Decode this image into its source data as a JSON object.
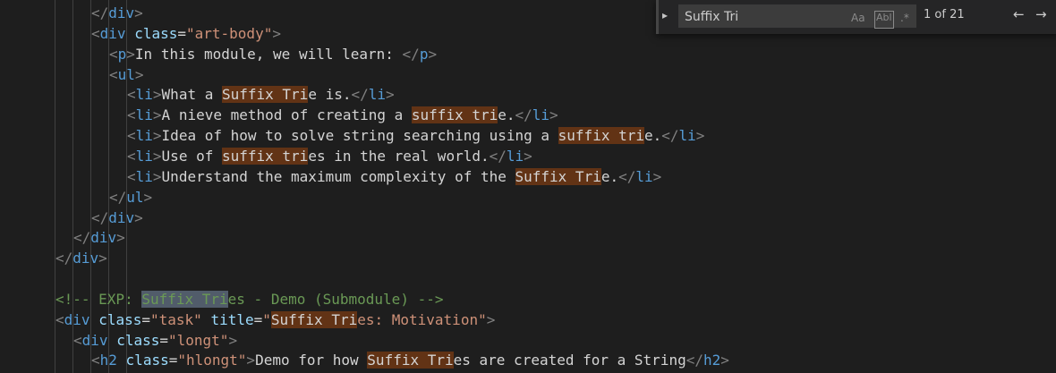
{
  "find_widget": {
    "toggle_icon": "chevron-right-icon",
    "query": "Suffix Tri",
    "match_case_label": "Aa",
    "whole_word_label": "Abl",
    "regex_label": ".*",
    "result_count": "1 of 21",
    "prev_icon": "arrow-left-icon",
    "next_icon": "arrow-right-icon"
  },
  "colors": {
    "background": "#1e1e1e",
    "tag": "#569cd6",
    "attribute": "#9cdcfe",
    "string": "#ce9178",
    "comment": "#6a9955",
    "match_highlight": "#623315",
    "current_match": "#515c6a"
  },
  "code": {
    "lines": [
      {
        "segs": [
          [
            "p",
            "</"
          ],
          [
            "tag",
            "div"
          ],
          [
            "p",
            ">"
          ]
        ]
      },
      {
        "segs": [
          [
            "p",
            "<"
          ],
          [
            "tag",
            "div"
          ],
          [
            "txt",
            " "
          ],
          [
            "attr",
            "class"
          ],
          [
            "txt",
            "="
          ],
          [
            "str",
            "\"art-body\""
          ],
          [
            "p",
            ">"
          ]
        ]
      },
      {
        "segs": [
          [
            "p",
            "<"
          ],
          [
            "tag",
            "p"
          ],
          [
            "p",
            ">"
          ],
          [
            "txt",
            "In this module, we will learn: "
          ],
          [
            "p",
            "</"
          ],
          [
            "tag",
            "p"
          ],
          [
            "p",
            ">"
          ]
        ]
      },
      {
        "segs": [
          [
            "p",
            "<"
          ],
          [
            "tag",
            "ul"
          ],
          [
            "p",
            ">"
          ]
        ]
      },
      {
        "segs": [
          [
            "p",
            "<"
          ],
          [
            "tag",
            "li"
          ],
          [
            "p",
            ">"
          ],
          [
            "txt",
            "What a "
          ],
          [
            "hl",
            "Suffix Tri"
          ],
          [
            "txt",
            "e is."
          ],
          [
            "p",
            "</"
          ],
          [
            "tag",
            "li"
          ],
          [
            "p",
            ">"
          ]
        ]
      },
      {
        "segs": [
          [
            "p",
            "<"
          ],
          [
            "tag",
            "li"
          ],
          [
            "p",
            ">"
          ],
          [
            "txt",
            "A nieve method of creating a "
          ],
          [
            "hl",
            "suffix tri"
          ],
          [
            "txt",
            "e."
          ],
          [
            "p",
            "</"
          ],
          [
            "tag",
            "li"
          ],
          [
            "p",
            ">"
          ]
        ]
      },
      {
        "segs": [
          [
            "p",
            "<"
          ],
          [
            "tag",
            "li"
          ],
          [
            "p",
            ">"
          ],
          [
            "txt",
            "Idea of how to solve string searching using a "
          ],
          [
            "hl",
            "suffix tri"
          ],
          [
            "txt",
            "e."
          ],
          [
            "p",
            "</"
          ],
          [
            "tag",
            "li"
          ],
          [
            "p",
            ">"
          ]
        ]
      },
      {
        "segs": [
          [
            "p",
            "<"
          ],
          [
            "tag",
            "li"
          ],
          [
            "p",
            ">"
          ],
          [
            "txt",
            "Use of "
          ],
          [
            "hl",
            "suffix tri"
          ],
          [
            "txt",
            "es in the real world."
          ],
          [
            "p",
            "</"
          ],
          [
            "tag",
            "li"
          ],
          [
            "p",
            ">"
          ]
        ]
      },
      {
        "segs": [
          [
            "p",
            "<"
          ],
          [
            "tag",
            "li"
          ],
          [
            "p",
            ">"
          ],
          [
            "txt",
            "Understand the maximum complexity of the "
          ],
          [
            "hl",
            "Suffix Tri"
          ],
          [
            "txt",
            "e."
          ],
          [
            "p",
            "</"
          ],
          [
            "tag",
            "li"
          ],
          [
            "p",
            ">"
          ]
        ]
      },
      {
        "segs": [
          [
            "p",
            "</"
          ],
          [
            "tag",
            "ul"
          ],
          [
            "p",
            ">"
          ]
        ]
      },
      {
        "segs": [
          [
            "p",
            "</"
          ],
          [
            "tag",
            "div"
          ],
          [
            "p",
            ">"
          ]
        ]
      },
      {
        "segs": [
          [
            "p",
            "</"
          ],
          [
            "tag",
            "div"
          ],
          [
            "p",
            ">"
          ]
        ]
      },
      {
        "segs": [
          [
            "p",
            "</"
          ],
          [
            "tag",
            "div"
          ],
          [
            "p",
            ">"
          ]
        ]
      },
      {
        "segs": []
      },
      {
        "segs": [
          [
            "com",
            "<!-- EXP: "
          ],
          [
            "cur",
            "Suffix Tri"
          ],
          [
            "com",
            "es - Demo (Submodule) -->"
          ]
        ]
      },
      {
        "segs": [
          [
            "p",
            "<"
          ],
          [
            "tag",
            "div"
          ],
          [
            "txt",
            " "
          ],
          [
            "attr",
            "class"
          ],
          [
            "txt",
            "="
          ],
          [
            "str",
            "\"task\""
          ],
          [
            "txt",
            " "
          ],
          [
            "attr",
            "title"
          ],
          [
            "txt",
            "="
          ],
          [
            "str",
            "\""
          ],
          [
            "hl",
            "Suffix Tri"
          ],
          [
            "str",
            "es: Motivation\""
          ],
          [
            "p",
            ">"
          ]
        ]
      },
      {
        "segs": [
          [
            "p",
            "<"
          ],
          [
            "tag",
            "div"
          ],
          [
            "txt",
            " "
          ],
          [
            "attr",
            "class"
          ],
          [
            "txt",
            "="
          ],
          [
            "str",
            "\"longt\""
          ],
          [
            "p",
            ">"
          ]
        ]
      },
      {
        "segs": [
          [
            "p",
            "<"
          ],
          [
            "tag",
            "h2"
          ],
          [
            "txt",
            " "
          ],
          [
            "attr",
            "class"
          ],
          [
            "txt",
            "="
          ],
          [
            "str",
            "\"hlongt\""
          ],
          [
            "p",
            ">"
          ],
          [
            "txt",
            "Demo for how "
          ],
          [
            "hl",
            "Suffix Tri"
          ],
          [
            "txt",
            "es are created for a String"
          ],
          [
            "p",
            "</"
          ],
          [
            "tag",
            "h2"
          ],
          [
            "p",
            ">"
          ]
        ]
      }
    ]
  }
}
